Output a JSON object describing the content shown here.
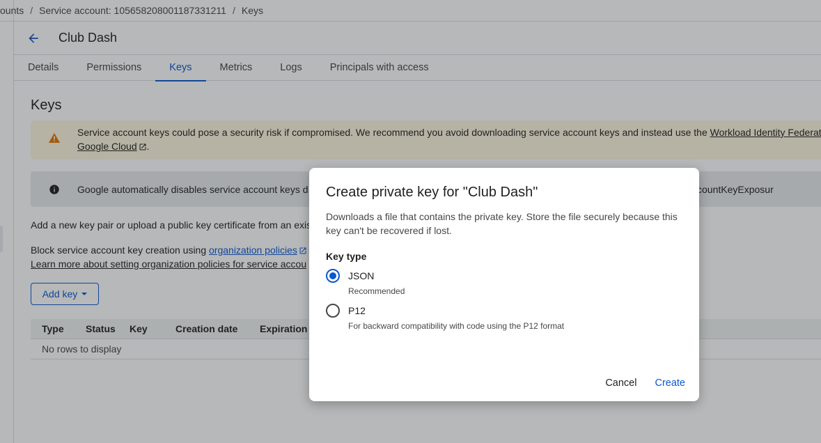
{
  "breadcrumb": {
    "items": [
      "ounts",
      "Service account: 105658208001187331211",
      "Keys"
    ],
    "separator": "/"
  },
  "header": {
    "title": "Club Dash"
  },
  "tabs": [
    "Details",
    "Permissions",
    "Keys",
    "Metrics",
    "Logs",
    "Principals with access"
  ],
  "active_tab": "Keys",
  "keys_section": {
    "title": "Keys",
    "warning": {
      "text_before": "Service account keys could pose a security risk if compromised. We recommend you avoid downloading service account keys and instead use the ",
      "link1": "Workload Identity Federation",
      "line2_link": "Google Cloud",
      "line2_after": "."
    },
    "info": {
      "text_left": "Google automatically disables service account keys d",
      "text_right": "countKeyExposureResponse"
    },
    "add_pair_text": "Add a new key pair or upload a public key certificate from an exis",
    "block_text": "Block service account key creation using ",
    "block_link": "organization policies",
    "learn_more": "Learn more about setting organization policies for service accou",
    "add_key_label": "Add key",
    "table": {
      "columns": [
        "Type",
        "Status",
        "Key",
        "Creation date",
        "Expiration d"
      ],
      "empty": "No rows to display"
    }
  },
  "dialog": {
    "title": "Create private key for \"Club Dash\"",
    "description": "Downloads a file that contains the private key. Store the file securely because this key can't be recovered if lost.",
    "key_type_label": "Key type",
    "options": [
      {
        "label": "JSON",
        "sub": "Recommended",
        "checked": true
      },
      {
        "label": "P12",
        "sub": "For backward compatibility with code using the P12 format",
        "checked": false
      }
    ],
    "cancel_label": "Cancel",
    "create_label": "Create"
  },
  "colors": {
    "accent": "#0b57d0",
    "warning_bg": "#fef7e0",
    "warning_icon": "#e37400",
    "scrim": "rgba(32,33,36,0.32)"
  },
  "icons": {
    "back": "arrow-left-icon",
    "warning": "warning-triangle-icon",
    "info": "info-icon",
    "external": "external-link-icon"
  }
}
